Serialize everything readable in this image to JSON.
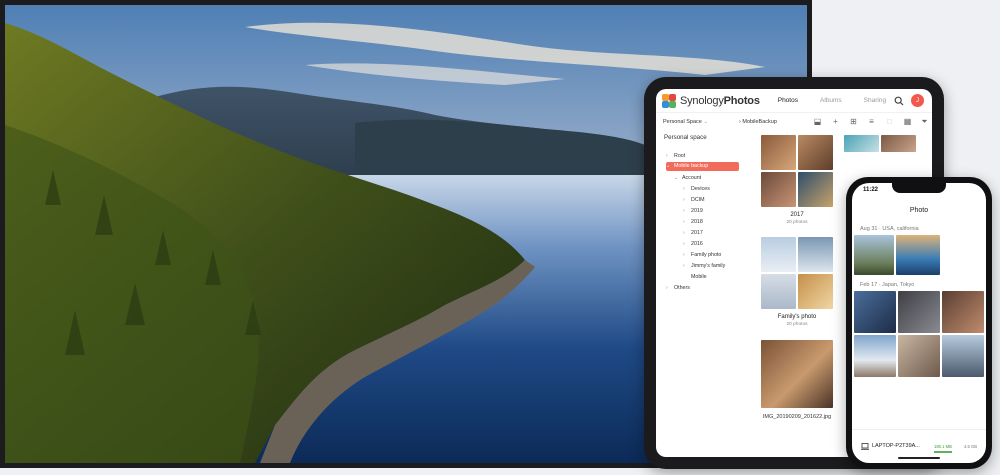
{
  "colors": {
    "accent": "#f26c5c",
    "avatar": "#f2584c"
  },
  "tablet": {
    "brand_light": "Synology",
    "brand_bold": "Photos",
    "tabs": [
      "Photos",
      "Albums",
      "Sharing"
    ],
    "avatar_initial": "J",
    "space_label": "Personal Space",
    "breadcrumb": "› MobileBackup",
    "tree": {
      "title": "Personal space",
      "items": [
        "Root",
        "Mobile backup",
        "Account",
        "Devices",
        "DCIM",
        "2019",
        "2018",
        "2017",
        "2016",
        "Family photo",
        "Jimmy's family",
        "Mobile",
        "Others"
      ]
    },
    "albums": [
      {
        "name": "2017",
        "count": "20 photos"
      },
      {
        "name": "Family's photo",
        "count": "20 photos"
      }
    ],
    "file_name": "IMG_20190209_201622.jpg"
  },
  "phone": {
    "time": "11:22",
    "title": "Photo",
    "groups": [
      {
        "date": "Aug 31",
        "place": "· USA, california"
      },
      {
        "date": "Feb 17",
        "place": "· Japan, Tokyo"
      }
    ],
    "device": "LAPTOP-P2T39A...",
    "transferred": "180.1 MB",
    "total": "4.5 GB",
    "progress": 0.36
  }
}
